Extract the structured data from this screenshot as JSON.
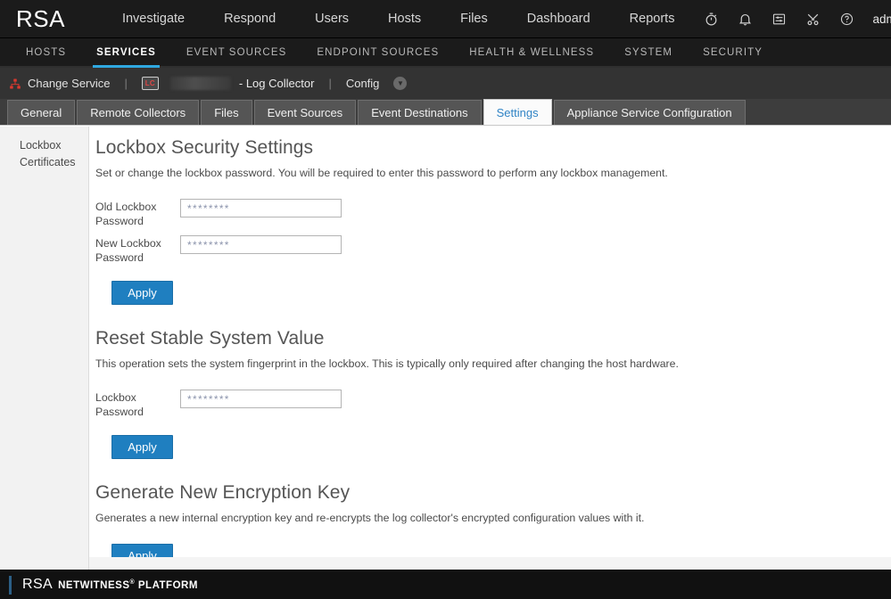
{
  "topnav": {
    "brand": "RSA",
    "links": [
      {
        "label": "Investigate"
      },
      {
        "label": "Respond"
      },
      {
        "label": "Users"
      },
      {
        "label": "Hosts"
      },
      {
        "label": "Files"
      },
      {
        "label": "Dashboard"
      },
      {
        "label": "Reports"
      }
    ],
    "icons": [
      {
        "name": "timer-icon"
      },
      {
        "name": "bell-icon"
      },
      {
        "name": "tasks-icon"
      },
      {
        "name": "tools-icon"
      },
      {
        "name": "help-question-icon"
      }
    ],
    "admin_label": "admin",
    "help_label": "?"
  },
  "subnav": {
    "items": [
      {
        "label": "HOSTS",
        "active": false
      },
      {
        "label": "SERVICES",
        "active": true
      },
      {
        "label": "EVENT SOURCES",
        "active": false
      },
      {
        "label": "ENDPOINT SOURCES",
        "active": false
      },
      {
        "label": "HEALTH & WELLNESS",
        "active": false
      },
      {
        "label": "SYSTEM",
        "active": false
      },
      {
        "label": "SECURITY",
        "active": false
      }
    ],
    "active_accent": "#2fa8e0"
  },
  "servicebar": {
    "change_service": "Change Service",
    "separator": "|",
    "service_badge": "LC",
    "service_name": "- Log Collector",
    "config_label": "Config"
  },
  "tabs": [
    {
      "label": "General",
      "active": false
    },
    {
      "label": "Remote Collectors",
      "active": false
    },
    {
      "label": "Files",
      "active": false
    },
    {
      "label": "Event Sources",
      "active": false
    },
    {
      "label": "Event Destinations",
      "active": false
    },
    {
      "label": "Settings",
      "active": true
    },
    {
      "label": "Appliance Service Configuration",
      "active": false
    }
  ],
  "sidebar": {
    "items": [
      {
        "label": "Lockbox"
      },
      {
        "label": "Certificates"
      }
    ]
  },
  "sections": [
    {
      "title": "Lockbox Security Settings",
      "description": "Set or change the lockbox password. You will be required to enter this password to perform any lockbox management.",
      "fields": [
        {
          "label": "Old Lockbox Password",
          "value": "",
          "placeholder": "********"
        },
        {
          "label": "New Lockbox Password",
          "value": "",
          "placeholder": "********"
        }
      ],
      "button": "Apply"
    },
    {
      "title": "Reset Stable System Value",
      "description": "This operation sets the system fingerprint in the lockbox. This is typically only required after changing the host hardware.",
      "fields": [
        {
          "label": "Lockbox Password",
          "value": "",
          "placeholder": "********"
        }
      ],
      "button": "Apply"
    },
    {
      "title": "Generate New Encryption Key",
      "description": "Generates a new internal encryption key and re-encrypts the log collector's encrypted configuration values with it.",
      "fields": [],
      "button": "Apply"
    }
  ],
  "footer": {
    "brand": "RSA",
    "product": "NETWITNESS",
    "trademark": "®",
    "platform": "PLATFORM"
  },
  "colors": {
    "accent_blue": "#2fa8e0",
    "button_blue": "#1f7fc0",
    "nav_dark": "#1b1b1b",
    "service_bar": "#333333",
    "tab_strip": "#3d3d3d"
  }
}
